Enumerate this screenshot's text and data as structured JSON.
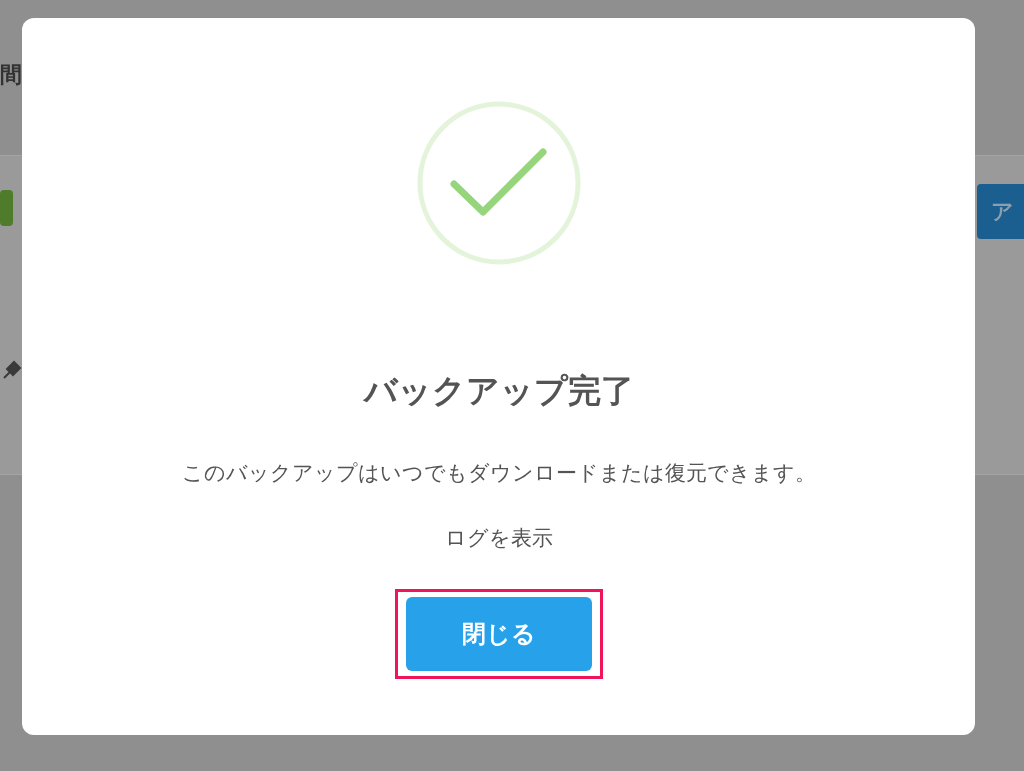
{
  "background_page": {
    "header_text": "間",
    "action_button": {
      "label": "ア"
    }
  },
  "dialog": {
    "title": "バックアップ完了",
    "message": "このバックアップはいつでもダウンロードまたは復元できます。",
    "log_link": "ログを表示",
    "close_button": {
      "label": "閉じる",
      "highlighted": true
    }
  }
}
